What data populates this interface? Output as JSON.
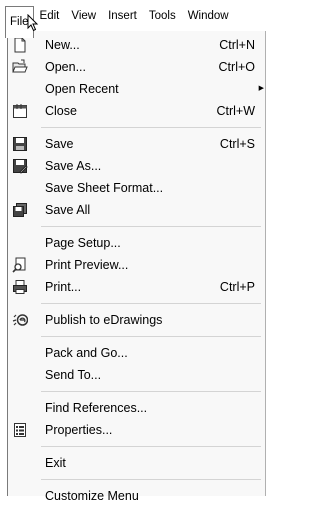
{
  "menubar": {
    "items": [
      "File",
      "Edit",
      "View",
      "Insert",
      "Tools",
      "Window"
    ]
  },
  "menu": {
    "new": {
      "label": "New...",
      "shortcut": "Ctrl+N"
    },
    "open": {
      "label": "Open...",
      "shortcut": "Ctrl+O"
    },
    "open_recent": {
      "label": "Open Recent"
    },
    "close": {
      "label": "Close",
      "shortcut": "Ctrl+W"
    },
    "save": {
      "label": "Save",
      "shortcut": "Ctrl+S"
    },
    "save_as": {
      "label": "Save As..."
    },
    "save_sheet_format": {
      "label": "Save Sheet Format..."
    },
    "save_all": {
      "label": "Save All"
    },
    "page_setup": {
      "label": "Page Setup..."
    },
    "print_preview": {
      "label": "Print Preview..."
    },
    "print": {
      "label": "Print...",
      "shortcut": "Ctrl+P"
    },
    "publish": {
      "label": "Publish to eDrawings"
    },
    "pack_and_go": {
      "label": "Pack and Go..."
    },
    "send_to": {
      "label": "Send To..."
    },
    "find_references": {
      "label": "Find References..."
    },
    "properties": {
      "label": "Properties..."
    },
    "exit": {
      "label": "Exit"
    },
    "customize": {
      "label": "Customize Menu"
    }
  },
  "icons": {
    "new": "new-document-icon",
    "open": "open-folder-icon",
    "close": "close-document-icon",
    "save": "save-floppy-icon",
    "save_as": "save-as-icon",
    "save_all": "save-all-icon",
    "print_preview": "print-preview-icon",
    "print": "printer-icon",
    "publish": "edrawings-icon",
    "properties": "properties-icon"
  }
}
